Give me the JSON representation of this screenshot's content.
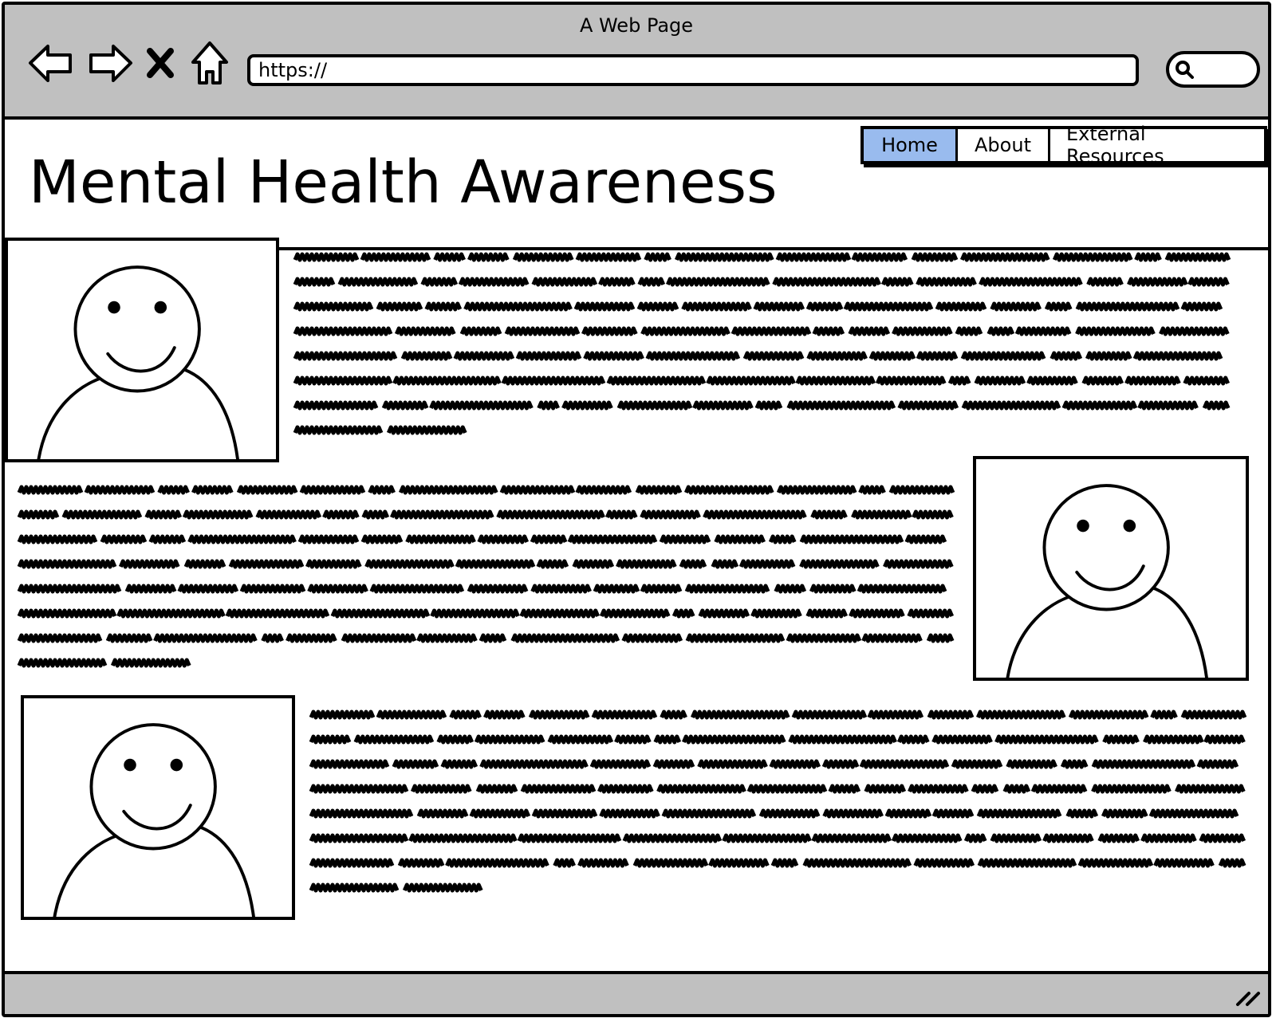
{
  "window": {
    "title": "A Web Page"
  },
  "browser": {
    "url": "https://",
    "icons": {
      "back": "arrow-left-icon",
      "forward": "arrow-right-icon",
      "stop": "close-icon",
      "home": "home-icon",
      "search": "search-icon"
    }
  },
  "page": {
    "title": "Mental Health Awareness",
    "nav": [
      {
        "label": "Home",
        "active": true
      },
      {
        "label": "About",
        "active": false
      },
      {
        "label": "External Resources",
        "active": false
      }
    ],
    "sections": [
      {
        "avatar": "person-placeholder-icon",
        "avatar_side": "left"
      },
      {
        "avatar": "person-placeholder-icon",
        "avatar_side": "right"
      },
      {
        "avatar": "person-placeholder-icon",
        "avatar_side": "left"
      }
    ]
  },
  "colors": {
    "chrome": "#c0c0c0",
    "active_tab": "#99bbee",
    "ink": "#000000"
  }
}
